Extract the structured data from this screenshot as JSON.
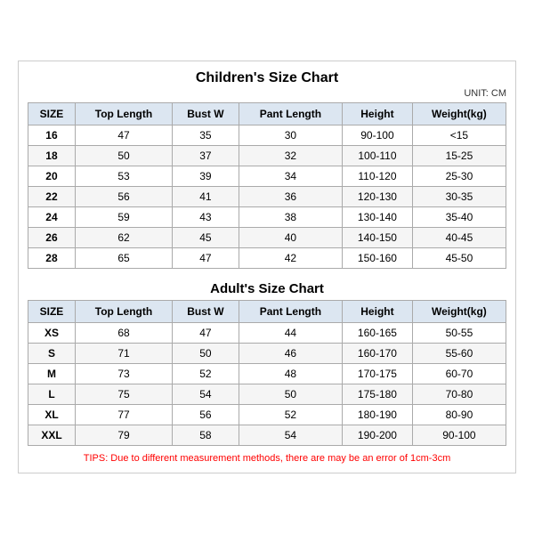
{
  "page": {
    "title": "Children's Size Chart",
    "unit": "UNIT: CM",
    "children_headers": [
      "SIZE",
      "Top Length",
      "Bust W",
      "Pant Length",
      "Height",
      "Weight(kg)"
    ],
    "children_rows": [
      [
        "16",
        "47",
        "35",
        "30",
        "90-100",
        "<15"
      ],
      [
        "18",
        "50",
        "37",
        "32",
        "100-110",
        "15-25"
      ],
      [
        "20",
        "53",
        "39",
        "34",
        "110-120",
        "25-30"
      ],
      [
        "22",
        "56",
        "41",
        "36",
        "120-130",
        "30-35"
      ],
      [
        "24",
        "59",
        "43",
        "38",
        "130-140",
        "35-40"
      ],
      [
        "26",
        "62",
        "45",
        "40",
        "140-150",
        "40-45"
      ],
      [
        "28",
        "65",
        "47",
        "42",
        "150-160",
        "45-50"
      ]
    ],
    "adults_title": "Adult's Size Chart",
    "adults_headers": [
      "SIZE",
      "Top Length",
      "Bust W",
      "Pant Length",
      "Height",
      "Weight(kg)"
    ],
    "adults_rows": [
      [
        "XS",
        "68",
        "47",
        "44",
        "160-165",
        "50-55"
      ],
      [
        "S",
        "71",
        "50",
        "46",
        "160-170",
        "55-60"
      ],
      [
        "M",
        "73",
        "52",
        "48",
        "170-175",
        "60-70"
      ],
      [
        "L",
        "75",
        "54",
        "50",
        "175-180",
        "70-80"
      ],
      [
        "XL",
        "77",
        "56",
        "52",
        "180-190",
        "80-90"
      ],
      [
        "XXL",
        "79",
        "58",
        "54",
        "190-200",
        "90-100"
      ]
    ],
    "tips": "TIPS: Due to different measurement methods, there are may be an error of 1cm-3cm"
  }
}
